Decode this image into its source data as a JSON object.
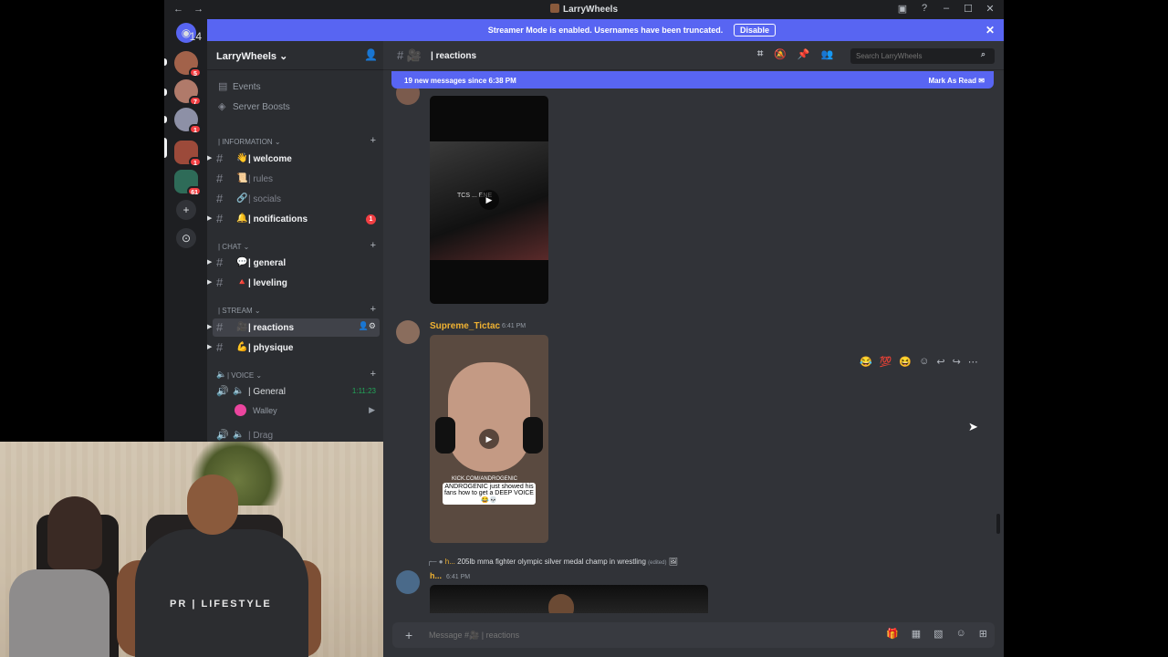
{
  "window": {
    "title": "LarryWheels",
    "nav_back": "←",
    "nav_forward": "→",
    "controls": [
      "▣",
      "?",
      "–",
      "☐",
      "✕"
    ]
  },
  "banner": {
    "text": "Streamer Mode is enabled. Usernames have been truncated.",
    "disable_label": "Disable",
    "close": "✕"
  },
  "guilds": [
    {
      "badge": "14"
    },
    {
      "badge": "5"
    },
    {
      "badge": "7"
    },
    {
      "badge": "1"
    },
    {
      "badge": "1"
    },
    {
      "badge": "61"
    }
  ],
  "server": {
    "name": "LarryWheels ⌄",
    "events": "Events",
    "boosts": "Server Boosts"
  },
  "categories": {
    "information": "| INFORMATION ⌄",
    "chat": "| CHAT ⌄",
    "stream": "| STREAM ⌄",
    "voice": "| VOICE ⌄"
  },
  "channels": {
    "welcome": {
      "emoji": "👋",
      "label": "| welcome"
    },
    "rules": {
      "emoji": "📜",
      "label": "| rules"
    },
    "socials": {
      "emoji": "🔗",
      "label": "| socials"
    },
    "notifications": {
      "emoji": "🔔",
      "label": "| notifications",
      "badge": "1"
    },
    "general": {
      "emoji": "💬",
      "label": "| general"
    },
    "leveling": {
      "emoji": "🔺",
      "label": "| leveling"
    },
    "reactions": {
      "emoji": "🎥",
      "label": "| reactions"
    },
    "physique": {
      "emoji": "💪",
      "label": "| physique"
    },
    "voice_general": {
      "label": "| General",
      "time": "1:11:23"
    },
    "voice_user": "Walley",
    "drag": {
      "label": "| Drag"
    }
  },
  "header": {
    "channel": "| reactions",
    "search_placeholder": "Search LarryWheels"
  },
  "new_messages": {
    "text": "19 new messages since 6:38 PM",
    "mark_read": "Mark As Read"
  },
  "messages": [
    {
      "overlay_text": "TCS ... ENE"
    },
    {
      "username": "Supreme_Tictac",
      "time": "6:41 PM",
      "caption": "ANDROGENIC just showed his fans how to get a DEEP VOICE 😂💀",
      "link": "KICK.COM/ANDROGENIC"
    },
    {
      "username": "h...",
      "time": "6:41 PM",
      "reply_text": "205lb mma fighter olympic silver medal champ in wrestling",
      "reply_user": "h...",
      "edited": "(edited)"
    }
  ],
  "hover_reactions": [
    "😂",
    "💯",
    "😆"
  ],
  "composer": {
    "placeholder": "Message #🎥 | reactions"
  },
  "webcam": {
    "shirt_text": "PR | LIFESTYLE"
  },
  "colors": {
    "blurple": "#5865f2",
    "username_gold": "#f0b232",
    "danger_red": "#f23f43",
    "voice_green": "#23a559"
  }
}
